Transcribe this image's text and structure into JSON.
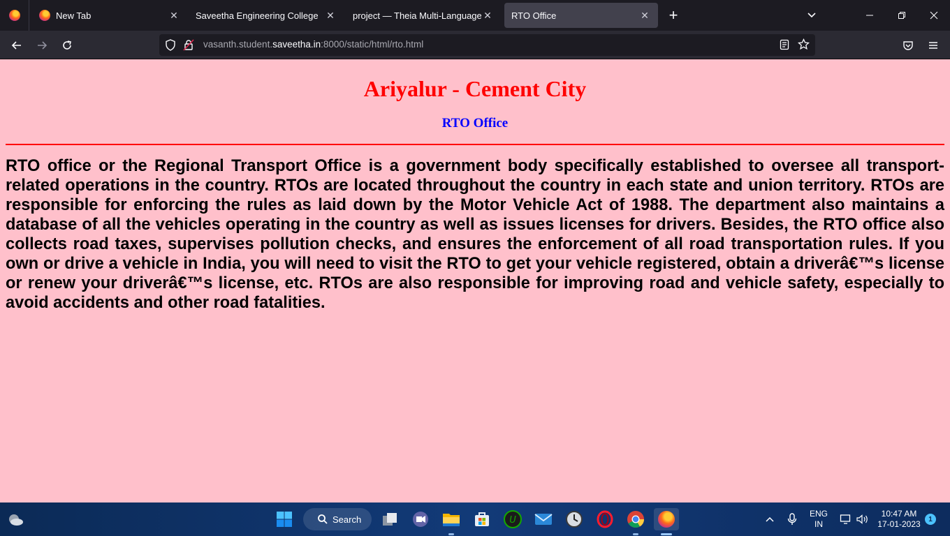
{
  "browser": {
    "tabs": [
      {
        "label": "New Tab",
        "icon": "firefox-icon"
      },
      {
        "label": "Saveetha Engineering College",
        "icon": "none"
      },
      {
        "label": "project — Theia Multi-Language Ex",
        "icon": "none"
      },
      {
        "label": "RTO Office",
        "icon": "none",
        "active": true
      }
    ],
    "url_prefix": "vasanth.student.",
    "url_domain": "saveetha.in",
    "url_suffix": ":8000/static/html/rto.html"
  },
  "page": {
    "heading": "Ariyalur - Cement City",
    "subheading": "RTO Office",
    "paragraph": "RTO office or the Regional Transport Office is a government body specifically established to oversee all transport-related operations in the country. RTOs are located throughout the country in each state and union territory. RTOs are responsible for enforcing the rules as laid down by the Motor Vehicle Act of 1988. The department also maintains a database of all the vehicles operating in the country as well as issues licenses for drivers. Besides, the RTO office also collects road taxes, supervises pollution checks, and ensures the enforcement of all road transportation rules. If you own or drive a vehicle in India, you will need to visit the RTO to get your vehicle registered, obtain a driverâ€™s license or renew your driverâ€™s license, etc. RTOs are also responsible for improving road and vehicle safety, especially to avoid accidents and other road fatalities.",
    "colors": {
      "background": "#ffc0cb",
      "heading": "#ff0000",
      "subheading": "#0000ff",
      "rule": "#ff0000"
    }
  },
  "taskbar": {
    "search_label": "Search",
    "lang_top": "ENG",
    "lang_bottom": "IN",
    "time": "10:47 AM",
    "date": "17-01-2023",
    "notification_count": "1"
  }
}
